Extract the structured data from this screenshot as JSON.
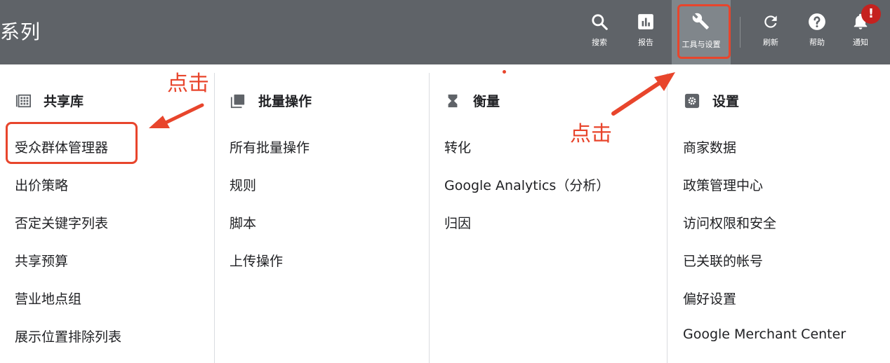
{
  "header": {
    "title": "系列",
    "buttons": [
      {
        "label": "搜索",
        "icon": "search-icon"
      },
      {
        "label": "报告",
        "icon": "reports-icon"
      },
      {
        "label": "工具与设置",
        "icon": "wrench-icon"
      },
      {
        "label": "刷新",
        "icon": "refresh-icon"
      },
      {
        "label": "帮助",
        "icon": "help-icon"
      },
      {
        "label": "通知",
        "icon": "bell-icon"
      }
    ],
    "notification_badge": "!"
  },
  "menu": {
    "columns": [
      {
        "heading": "共享库",
        "icon": "library-icon",
        "items": [
          "受众群体管理器",
          "出价策略",
          "否定关键字列表",
          "共享预算",
          "营业地点组",
          "展示位置排除列表"
        ]
      },
      {
        "heading": "批量操作",
        "icon": "bulk-actions-icon",
        "items": [
          "所有批量操作",
          "规则",
          "脚本",
          "上传操作"
        ]
      },
      {
        "heading": "衡量",
        "icon": "hourglass-icon",
        "items": [
          "转化",
          "Google Analytics（分析）",
          "归因"
        ]
      },
      {
        "heading": "设置",
        "icon": "settings-icon",
        "items": [
          "商家数据",
          "政策管理中心",
          "访问权限和安全",
          "已关联的帐号",
          "偏好设置",
          "Google Merchant Center"
        ]
      }
    ]
  },
  "annotations": {
    "click_label_left": "点击",
    "click_label_right": "点击",
    "color": "#e8452c"
  },
  "colors": {
    "topbar": "#5f6368",
    "tools_active": "#80868b",
    "badge": "#c5221f"
  }
}
